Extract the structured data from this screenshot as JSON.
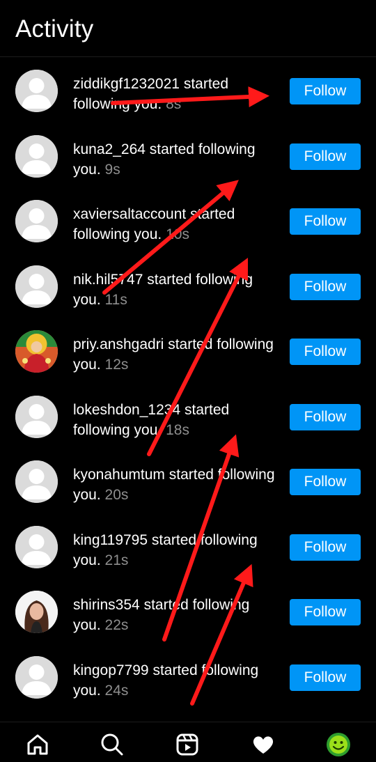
{
  "header": {
    "title": "Activity"
  },
  "notifications": [
    {
      "username": "ziddikgf1232021",
      "message": "started following you.",
      "time": "8s",
      "avatar": "default-avatar-icon",
      "button": "Follow"
    },
    {
      "username": "kuna2_264",
      "message": "started following you.",
      "time": "9s",
      "avatar": "default-avatar-icon",
      "button": "Follow"
    },
    {
      "username": "xaviersaltaccount",
      "message": "started following you.",
      "time": "10s",
      "avatar": "default-avatar-icon",
      "button": "Follow"
    },
    {
      "username": "nik.hil5747",
      "message": "started following you.",
      "time": "11s",
      "avatar": "default-avatar-icon",
      "button": "Follow"
    },
    {
      "username": "priy.anshgadri",
      "message": "started following you.",
      "time": "12s",
      "avatar": "photo-avatar-deity",
      "button": "Follow"
    },
    {
      "username": "lokeshdon_1234",
      "message": "started following you.",
      "time": "18s",
      "avatar": "default-avatar-icon",
      "button": "Follow"
    },
    {
      "username": "kyonahumtum",
      "message": "started following you.",
      "time": "20s",
      "avatar": "default-avatar-icon",
      "button": "Follow"
    },
    {
      "username": "king119795",
      "message": "started following you.",
      "time": "21s",
      "avatar": "default-avatar-icon",
      "button": "Follow"
    },
    {
      "username": "shirins354",
      "message": "started following you.",
      "time": "22s",
      "avatar": "photo-avatar-portrait",
      "button": "Follow"
    },
    {
      "username": "kingop7799",
      "message": "started following you.",
      "time": "24s",
      "avatar": "default-avatar-icon",
      "button": "Follow"
    }
  ],
  "bottom_nav": [
    "home-icon",
    "search-icon",
    "reels-icon",
    "heart-icon",
    "profile-avatar"
  ],
  "colors": {
    "accent": "#0095f6",
    "background": "#000000",
    "annotation": "#ff1a1a",
    "secondary_text": "#8e8e8e"
  }
}
